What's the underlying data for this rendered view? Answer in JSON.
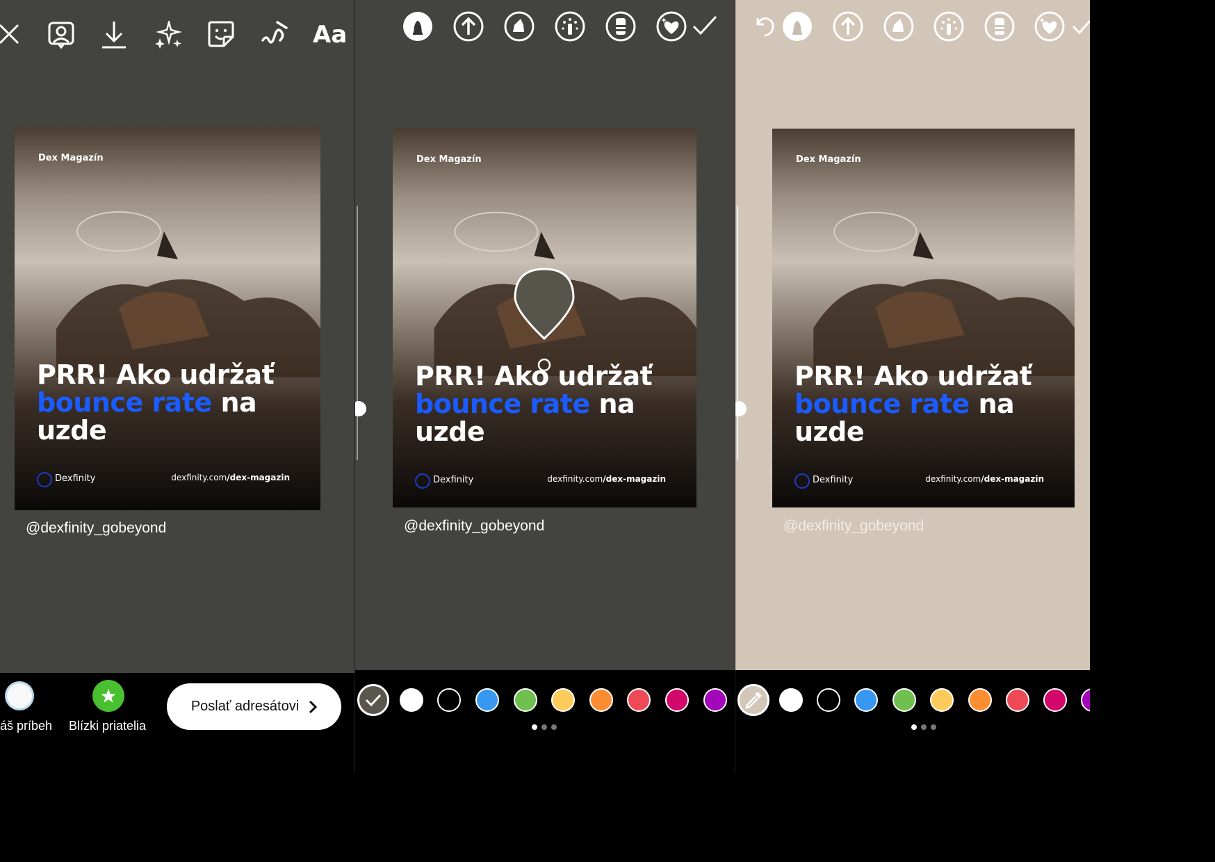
{
  "panel_left": {
    "toolbar": {
      "close_icon": "close-icon",
      "text_button_label": "Aa"
    },
    "card": {
      "magazine": "Dex Magazín",
      "headline_line1": "PRR! Ako udržať",
      "headline_blue": "bounce rate",
      "headline_na": " na",
      "headline_line3": "uzde",
      "logo": "Dexfinity",
      "url_plain": "dexfinity.com",
      "url_bold": "/dex-magazin"
    },
    "handle": "@dexfinity_gobeyond",
    "bottom": {
      "your_story": "áš príbeh",
      "close_friends": "Blízki priatelia",
      "send_label": "Poslať adresátovi"
    }
  },
  "panel_middle": {
    "card": {
      "magazine": "Dex Magazín",
      "headline_line1": "PRR! Ako udržať",
      "headline_blue": "bounce rate",
      "headline_na": " na",
      "headline_line3": "uzde",
      "logo": "Dexfinity",
      "url_plain": "dexfinity.com",
      "url_bold": "/dex-magazin"
    },
    "handle": "@dexfinity_gobeyond"
  },
  "panel_right": {
    "card": {
      "magazine": "Dex Magazín",
      "headline_line1": "PRR! Ako udržať",
      "headline_blue": "bounce rate",
      "headline_na": " na",
      "headline_line3": "uzde",
      "logo": "Dexfinity",
      "url_plain": "dexfinity.com",
      "url_bold": "/dex-magazin"
    },
    "handle": "@dexfinity_gobeyond"
  },
  "colors": {
    "panel_dark": "#434440",
    "panel_beige": "#d2c6b8",
    "accent_blue": "#1a5cff",
    "palette": [
      "#ffffff",
      "#000000",
      "#3897f0",
      "#70c050",
      "#fdcb5c",
      "#fd8d32",
      "#ed4956",
      "#d10869",
      "#a307ba"
    ]
  }
}
